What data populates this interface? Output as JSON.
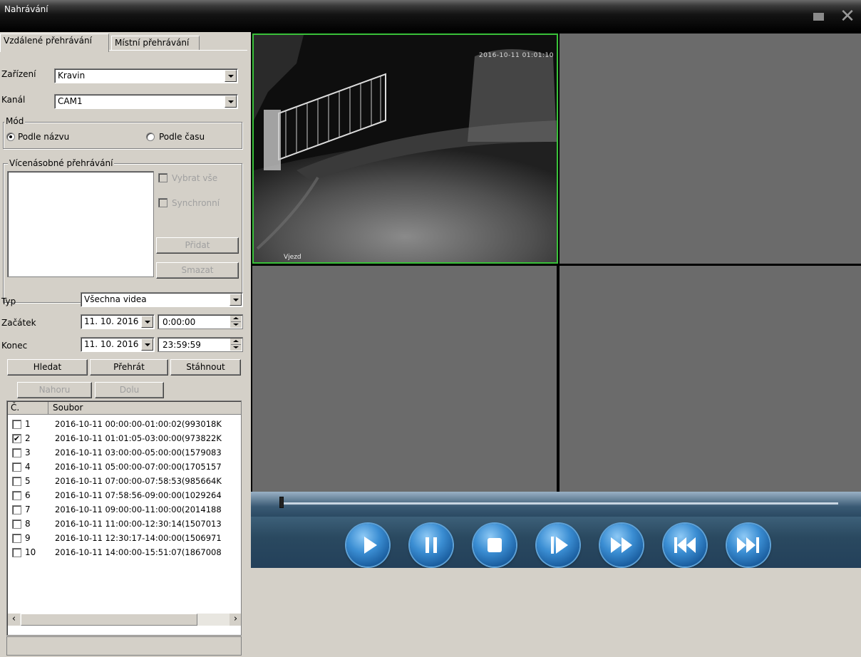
{
  "window": {
    "title": "Nahrávání"
  },
  "tabs": [
    {
      "label": "Vzdálené přehrávání",
      "active": true
    },
    {
      "label": "Místní přehrávání",
      "active": false
    }
  ],
  "device": {
    "label": "Zařízení",
    "value": "Kravin"
  },
  "channel": {
    "label": "Kanál",
    "value": "CAM1"
  },
  "mode": {
    "title": "Mód",
    "by_name": "Podle názvu",
    "by_time": "Podle času",
    "selected": "by_name"
  },
  "multi": {
    "title": "Vícenásobné přehrávání",
    "select_all": "Vybrat vše",
    "sync": "Synchronní",
    "add": "Přidat",
    "remove": "Smazat"
  },
  "type": {
    "label": "Typ",
    "value": "Všechna videa"
  },
  "start": {
    "label": "Začátek",
    "date": "11. 10. 2016",
    "time": "0:00:00"
  },
  "end": {
    "label": "Konec",
    "date": "11. 10. 2016",
    "time": "23:59:59"
  },
  "buttons": {
    "search": "Hledat",
    "play": "Přehrát",
    "download": "Stáhnout",
    "up": "Nahoru",
    "down": "Dolu"
  },
  "file_list": {
    "columns": [
      "Č.",
      "Soubor"
    ],
    "rows": [
      {
        "num": "1",
        "file": "2016-10-11 00:00:00-01:00:02(993018K",
        "checked": false
      },
      {
        "num": "2",
        "file": "2016-10-11 01:01:05-03:00:00(973822K",
        "checked": true
      },
      {
        "num": "3",
        "file": "2016-10-11 03:00:00-05:00:00(1579083",
        "checked": false
      },
      {
        "num": "4",
        "file": "2016-10-11 05:00:00-07:00:00(1705157",
        "checked": false
      },
      {
        "num": "5",
        "file": "2016-10-11 07:00:00-07:58:53(985664K",
        "checked": false
      },
      {
        "num": "6",
        "file": "2016-10-11 07:58:56-09:00:00(1029264",
        "checked": false
      },
      {
        "num": "7",
        "file": "2016-10-11 09:00:00-11:00:00(2014188",
        "checked": false
      },
      {
        "num": "8",
        "file": "2016-10-11 11:00:00-12:30:14(1507013",
        "checked": false
      },
      {
        "num": "9",
        "file": "2016-10-11 12:30:17-14:00:00(1506971",
        "checked": false
      },
      {
        "num": "10",
        "file": "2016-10-11 14:00:00-15:51:07(1867008",
        "checked": false
      }
    ]
  },
  "video": {
    "timestamp": "2016-10-11 01:01:10",
    "camera_label": "Vjezd",
    "active_border_color": "#39c139"
  },
  "playback_controls": [
    {
      "name": "play-icon"
    },
    {
      "name": "pause-icon"
    },
    {
      "name": "stop-icon"
    },
    {
      "name": "step-forward-icon"
    },
    {
      "name": "fast-forward-icon"
    },
    {
      "name": "skip-back-icon"
    },
    {
      "name": "skip-forward-icon"
    }
  ]
}
